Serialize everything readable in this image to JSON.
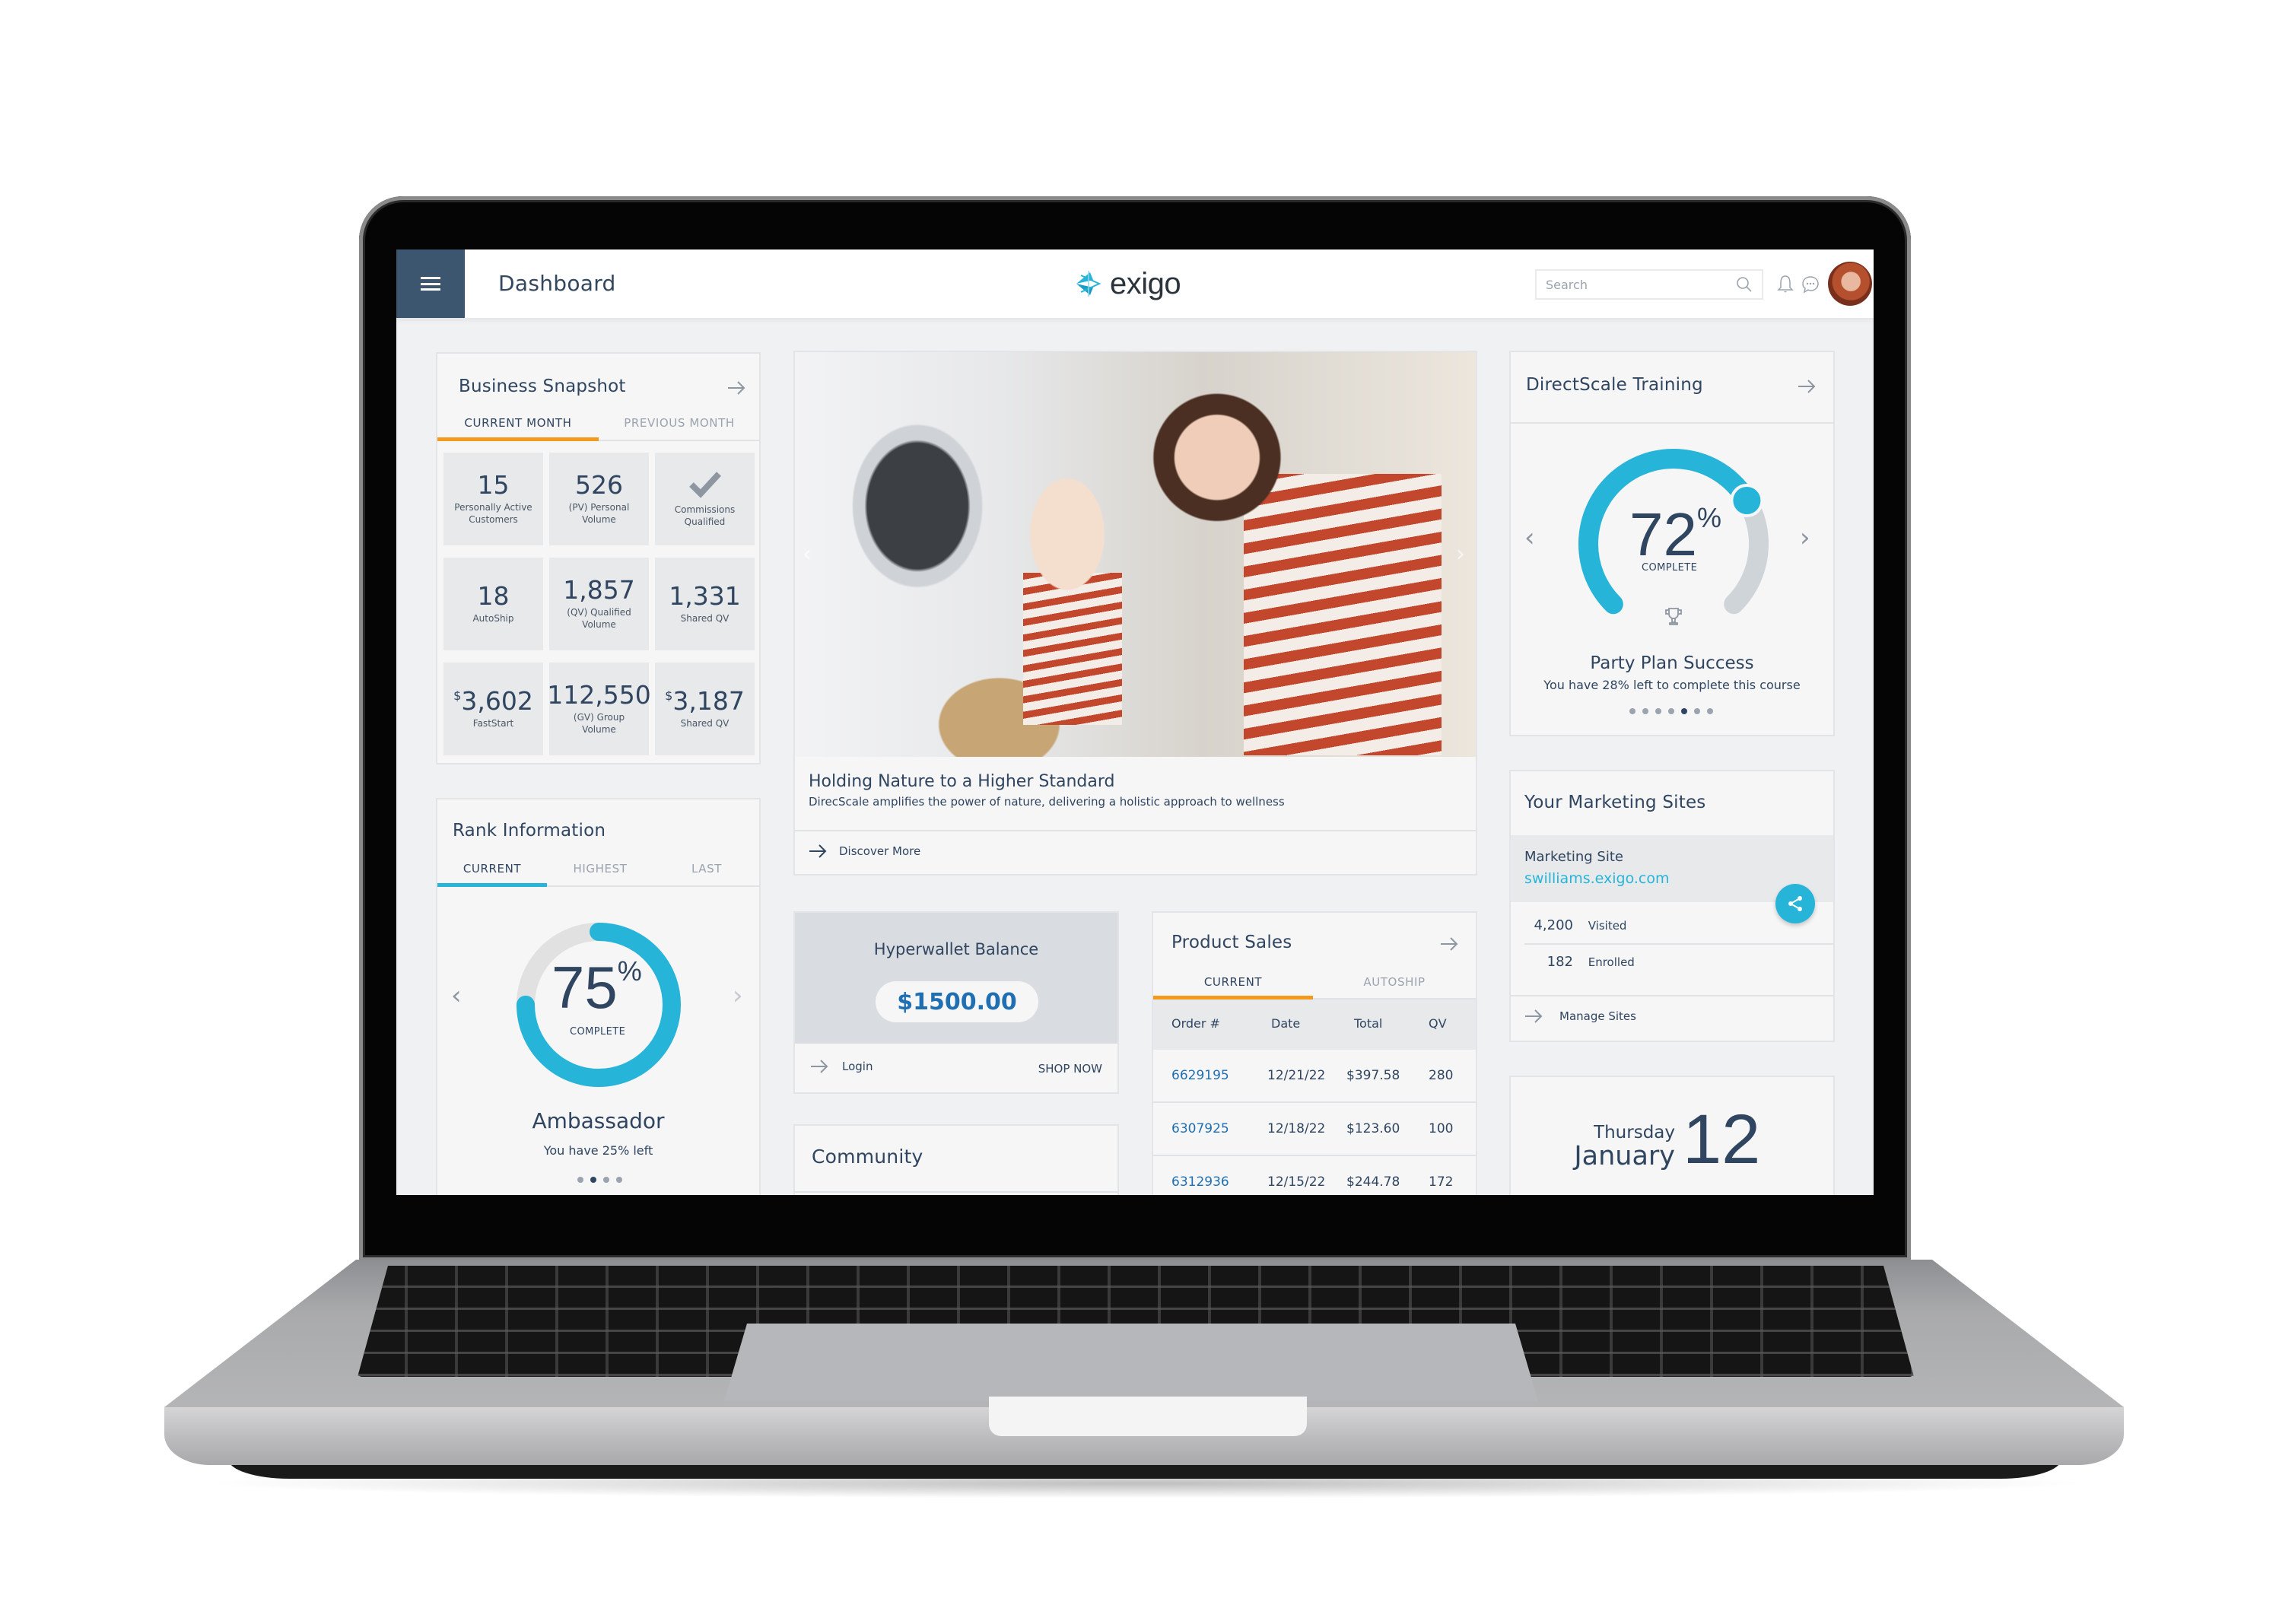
{
  "header": {
    "page_title": "Dashboard",
    "logo_text": "exigo",
    "search_placeholder": "Search",
    "icons": [
      "menu-icon",
      "search-icon",
      "bell-icon",
      "chat-icon",
      "avatar"
    ]
  },
  "business_snapshot": {
    "title": "Business Snapshot",
    "tabs": [
      {
        "label": "CURRENT MONTH",
        "active": true
      },
      {
        "label": "PREVIOUS MONTH",
        "active": false
      }
    ],
    "tiles": [
      {
        "value": "15",
        "label": "Personally Active Customers"
      },
      {
        "value": "526",
        "label": "(PV) Personal Volume"
      },
      {
        "icon": "checkmark-icon",
        "label": "Commissions Qualified"
      },
      {
        "value": "18",
        "label": "AutoShip"
      },
      {
        "value": "1,857",
        "label": "(QV) Qualified Volume"
      },
      {
        "value": "1,331",
        "label": "Shared QV"
      },
      {
        "currency": "$",
        "value": "3,602",
        "label": "FastStart"
      },
      {
        "value": "112,550",
        "label": "(GV) Group Volume"
      },
      {
        "currency": "$",
        "value": "3,187",
        "label": "Shared QV"
      }
    ]
  },
  "rank_information": {
    "title": "Rank Information",
    "tabs": [
      {
        "label": "CURRENT",
        "active": true
      },
      {
        "label": "HIGHEST",
        "active": false
      },
      {
        "label": "LAST",
        "active": false
      }
    ],
    "percent": 75,
    "percent_label": "75",
    "percent_sign": "%",
    "complete_label": "COMPLETE",
    "rank_name": "Ambassador",
    "remaining_text": "You have 25% left",
    "carousel_dots": 4,
    "active_dot": 1
  },
  "hero": {
    "image_alt": "Mother and daughter doing laundry",
    "headline": "Holding Nature to a Higher Standard",
    "subtext": "DirecScale amplifies the power of nature, delivering a holistic approach to wellness",
    "link_label": "Discover More"
  },
  "hyperwallet": {
    "title": "Hyperwallet Balance",
    "balance": "$1500.00",
    "login_label": "Login",
    "shop_label": "SHOP NOW"
  },
  "community": {
    "title": "Community"
  },
  "product_sales": {
    "title": "Product Sales",
    "tabs": [
      {
        "label": "CURRENT",
        "active": true
      },
      {
        "label": "AUTOSHIP",
        "active": false
      }
    ],
    "columns": [
      "Order #",
      "Date",
      "Total",
      "QV"
    ],
    "rows": [
      {
        "order": "6629195",
        "date": "12/21/22",
        "total": "$397.58",
        "qv": "280"
      },
      {
        "order": "6307925",
        "date": "12/18/22",
        "total": "$123.60",
        "qv": "100"
      },
      {
        "order": "6312936",
        "date": "12/15/22",
        "total": "$244.78",
        "qv": "172"
      }
    ]
  },
  "training": {
    "title": "DirectScale Training",
    "percent": 72,
    "percent_label": "72",
    "percent_sign": "%",
    "complete_label": "COMPLETE",
    "course_name": "Party Plan Success",
    "remaining_text": "You have 28% left to complete this course",
    "carousel_dots": 7,
    "active_dot": 4
  },
  "marketing_sites": {
    "title": "Your Marketing Sites",
    "site_label": "Marketing Site",
    "site_url": "swilliams.exigo.com",
    "stats": [
      {
        "value": "4,200",
        "label": "Visited"
      },
      {
        "value": "182",
        "label": "Enrolled"
      }
    ],
    "manage_label": "Manage Sites"
  },
  "date_widget": {
    "weekday": "Thursday",
    "month": "January",
    "day": "12"
  },
  "colors": {
    "navy": "#2f4560",
    "menu_bg": "#3d566f",
    "accent_cyan": "#26b5d9",
    "accent_orange": "#f39a1e",
    "link_blue": "#1f6fb2"
  }
}
